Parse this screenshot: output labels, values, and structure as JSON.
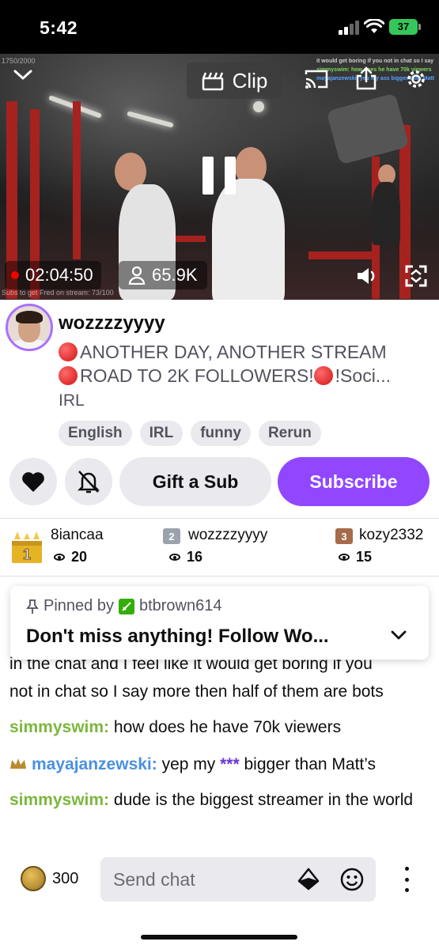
{
  "status_bar": {
    "time": "5:42",
    "battery": "37"
  },
  "video": {
    "overlay_top_left": "1750/2000",
    "overlay_bottom_left": "Subs to get Fred on stream: 73/100",
    "overlay_chat": [
      {
        "text": "it would get boring if you not in chat so I say",
        "color": "white"
      },
      {
        "text": "simmyswim: how does he have 70k viewers",
        "color": "green"
      },
      {
        "text": "mayajanzewski: yep my ass bigger than Matt",
        "color": "blue"
      }
    ],
    "clip_label": "Clip",
    "elapsed": "02:04:50",
    "viewers": "65.9K"
  },
  "channel": {
    "name": "wozzzzyyyy",
    "title_line1": "ANOTHER DAY, ANOTHER STREAM",
    "title_line2a": "ROAD TO 2K FOLLOWERS! ",
    "title_line2b": "!Soci...",
    "category": "IRL",
    "tags": [
      "English",
      "IRL",
      "funny",
      "Rerun"
    ]
  },
  "actions": {
    "gift": "Gift a Sub",
    "subscribe": "Subscribe",
    "accent": "#9147ff"
  },
  "leaderboard": [
    {
      "rank": "1",
      "name": "8iancaa",
      "count": "20"
    },
    {
      "rank": "2",
      "name": "wozzzzyyyy",
      "count": "16"
    },
    {
      "rank": "3",
      "name": "kozy2332",
      "count": "15"
    }
  ],
  "pinned": {
    "label_prefix": "Pinned by",
    "by": "btbrown614",
    "text": "Don't miss anything! Follow Wo..."
  },
  "chat": {
    "partial_line1": "in the chat and I feel like it would get boring if you",
    "partial_line2": "not in chat so I say more then half of them are bots",
    "m1_user": "simmyswim:",
    "m1_text": " how does he have 70k viewers",
    "m2_user": "mayajanzewski:",
    "m2_text_a": " yep my ",
    "m2_censored": "***",
    "m2_text_b": " bigger than Matt’s",
    "m3_user": "simmyswim:",
    "m3_text": " dude is the biggest streamer in the world"
  },
  "input": {
    "points": "300",
    "placeholder": "Send chat"
  }
}
